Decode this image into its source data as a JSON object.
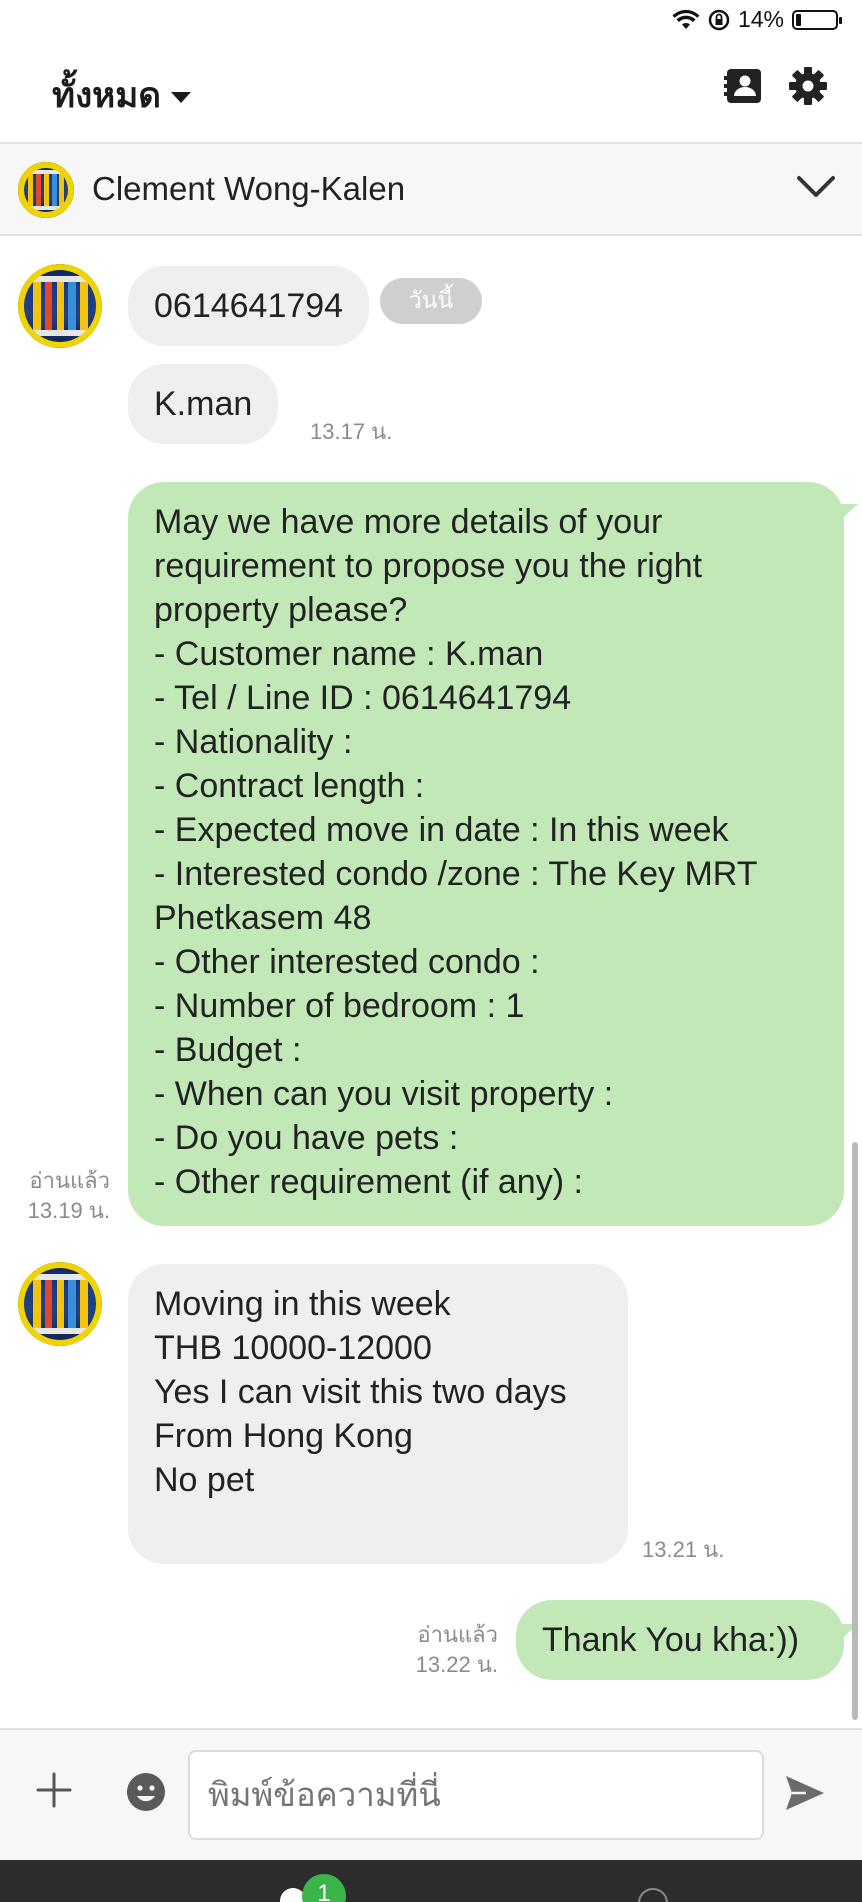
{
  "status_bar": {
    "battery_text": "14%",
    "battery_level_percent": 14
  },
  "header": {
    "filter_label": "ทั้งหมด",
    "icons": [
      "contacts-icon",
      "gear-icon"
    ]
  },
  "chat": {
    "contact_name": "Clement Wong-Kalen"
  },
  "messages": [
    {
      "from": "contact",
      "text": "0614641794",
      "badge": "วันนี้"
    },
    {
      "from": "contact",
      "text": "K.man",
      "time": "13.17 น."
    },
    {
      "from": "me",
      "text": "May we have more details of your\nrequirement to propose you the right\nproperty please?\n- Customer name : K.man\n- Tel / Line ID : 0614641794\n- Nationality :\n- Contract length :\n- Expected move in date : In this week\n- Interested condo /zone : The Key MRT\nPhetkasem 48\n- Other interested condo :\n- Number of bedroom  : 1\n- Budget :\n- When can you visit property :\n- Do you have pets :\n- Other requirement (if any) :",
      "read": "อ่านแล้ว",
      "time": "13.19 น."
    },
    {
      "from": "contact",
      "text": "Moving in this week\nTHB 10000-12000\nYes I can visit this two days\nFrom Hong Kong\nNo pet",
      "time": "13.21 น."
    },
    {
      "from": "me",
      "text": "Thank You kha:))",
      "read": "อ่านแล้ว",
      "time": "13.22 น."
    }
  ],
  "composer": {
    "placeholder": "พิมพ์ข้อความที่นี่"
  },
  "bottom_nav": {
    "badge_count": "1"
  },
  "colors": {
    "outgoing_bubble": "#c2e8b8",
    "incoming_bubble": "#eeeff1",
    "badge_green": "#3bb54a"
  }
}
